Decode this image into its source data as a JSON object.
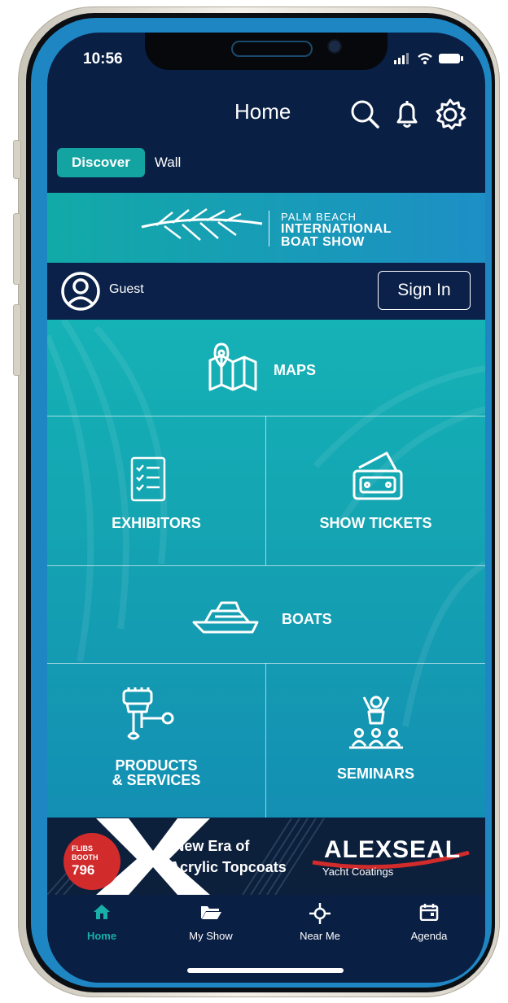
{
  "status": {
    "time": "10:56"
  },
  "header": {
    "title": "Home"
  },
  "tabs": [
    {
      "label": "Discover"
    },
    {
      "label": "Wall"
    }
  ],
  "banner": {
    "line1": "PALM BEACH",
    "line2": "INTERNATIONAL",
    "line3": "BOAT SHOW"
  },
  "user": {
    "name": "Guest",
    "signin_label": "Sign In"
  },
  "tiles": {
    "maps": "MAPS",
    "exhibitors": "EXHIBITORS",
    "tickets": "SHOW TICKETS",
    "boats": "BOATS",
    "products_line1": "PRODUCTS",
    "products_line2": "& SERVICES",
    "seminars": "SEMINARS"
  },
  "ad": {
    "badge_line1": "FLIBS",
    "badge_line2": "BOOTH",
    "badge_number": "796",
    "headline1": "A New Era of",
    "headline2": "Acrylic Topcoats",
    "brand": "ALEXSEAL",
    "brand_sub": "Yacht Coatings"
  },
  "nav": [
    {
      "label": "Home"
    },
    {
      "label": "My Show"
    },
    {
      "label": "Near Me"
    },
    {
      "label": "Agenda"
    }
  ],
  "colors": {
    "accent": "#13a3a0",
    "background": "#0a1f44",
    "tile": "#15b2b6",
    "ad_red": "#d22b2b"
  }
}
